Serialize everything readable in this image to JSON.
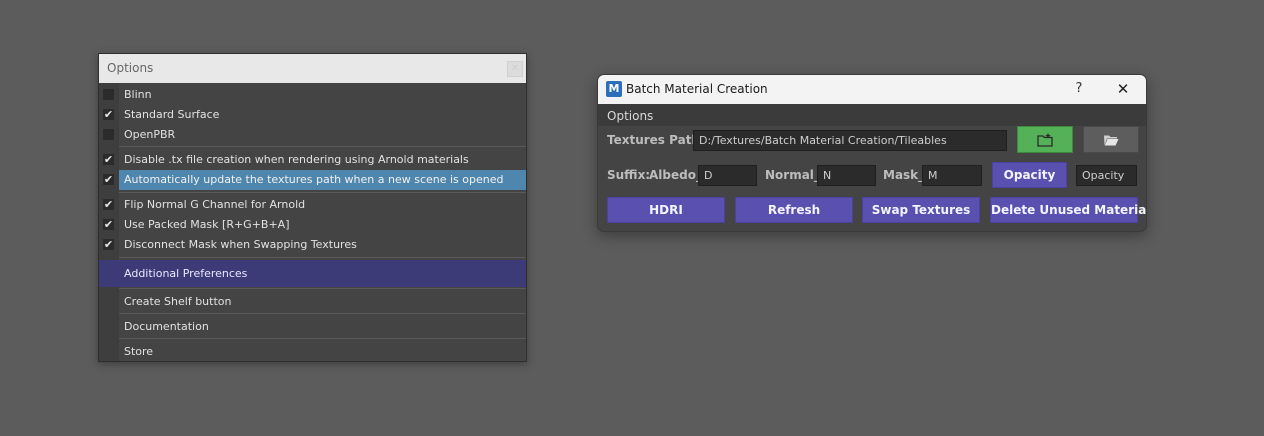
{
  "options_menu": {
    "title": "Options",
    "close_icon": "close-icon",
    "items": [
      {
        "label": "Blinn",
        "checked": false
      },
      {
        "label": "Standard Surface",
        "checked": true
      },
      {
        "label": "OpenPBR",
        "checked": false
      },
      {
        "label": "Disable .tx file creation when rendering using Arnold materials",
        "checked": true
      },
      {
        "label": "Automatically update the textures path when a new scene is opened",
        "checked": true,
        "highlighted": true
      },
      {
        "label": "Flip Normal G Channel for Arnold",
        "checked": true
      },
      {
        "label": "Use Packed Mask [R+G+B+A]",
        "checked": true
      },
      {
        "label": "Disconnect Mask when Swapping Textures",
        "checked": true
      }
    ],
    "additional_preferences": "Additional Preferences",
    "create_shelf_button": "Create Shelf button",
    "documentation": "Documentation",
    "store": "Store",
    "check_glyph": "✔",
    "highlight_color": "#4f86ad",
    "submenu_color": "#3d3a78"
  },
  "batch_window": {
    "logo_letter": "M",
    "title": "Batch Material Creation",
    "help_label": "?",
    "close_label": "✕",
    "menu_options": "Options",
    "textures_path_label": "Textures Path:",
    "textures_path_value": "D:/Textures/Batch Material Creation/Tileables",
    "add_folder_icon": "folder-add-icon",
    "browse_folder_icon": "folder-open-icon",
    "suffix_label": "Suffix:",
    "albedo_label": "Albedo_",
    "albedo_value": "D",
    "normal_label": "Normal_",
    "normal_value": "N",
    "mask_label": "Mask_",
    "mask_value": "M",
    "opacity_button": "Opacity",
    "opacity_value": "Opacity",
    "hdri_button": "HDRI",
    "refresh_button": "Refresh",
    "swap_textures_button": "Swap Textures",
    "delete_unused_button": "Delete Unused Materials",
    "accent_purple": "#5a50b0",
    "accent_green": "#55b157"
  }
}
